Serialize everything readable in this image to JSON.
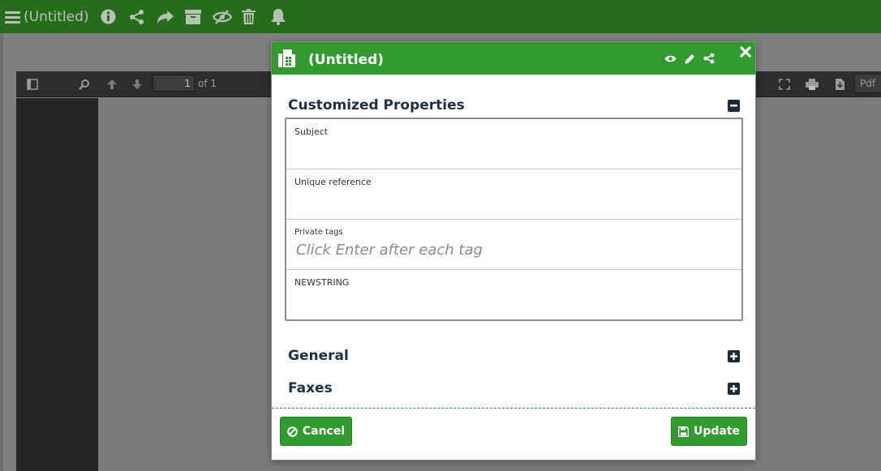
{
  "app": {
    "title": "(Untitled)",
    "colors": {
      "topbar": "#256d1b",
      "accent": "#339a30",
      "icon": "#b7c2b4"
    },
    "toolbar_icons": [
      "menu-icon",
      "info-icon",
      "share-icon",
      "forward-icon",
      "archive-icon",
      "hide-icon",
      "trash-icon",
      "bell-icon"
    ]
  },
  "viewer": {
    "page_value": "1",
    "page_of": "of 1",
    "zoom_select": "Pdf"
  },
  "modal": {
    "title": "(Untitled)",
    "header_icons": [
      "fax-icon",
      "eye-icon",
      "pencil-icon",
      "share-icon",
      "close-icon"
    ],
    "sections": {
      "customized": "Customized Properties",
      "general": "General",
      "faxes": "Faxes"
    },
    "fields": {
      "subject": {
        "label": "Subject",
        "value": ""
      },
      "unique_reference": {
        "label": "Unique reference",
        "value": ""
      },
      "private_tags": {
        "label": "Private tags",
        "placeholder": "Click Enter after each tag"
      },
      "newstring": {
        "label": "NEWSTRING",
        "value": ""
      }
    },
    "buttons": {
      "cancel": "Cancel",
      "update": "Update"
    }
  }
}
